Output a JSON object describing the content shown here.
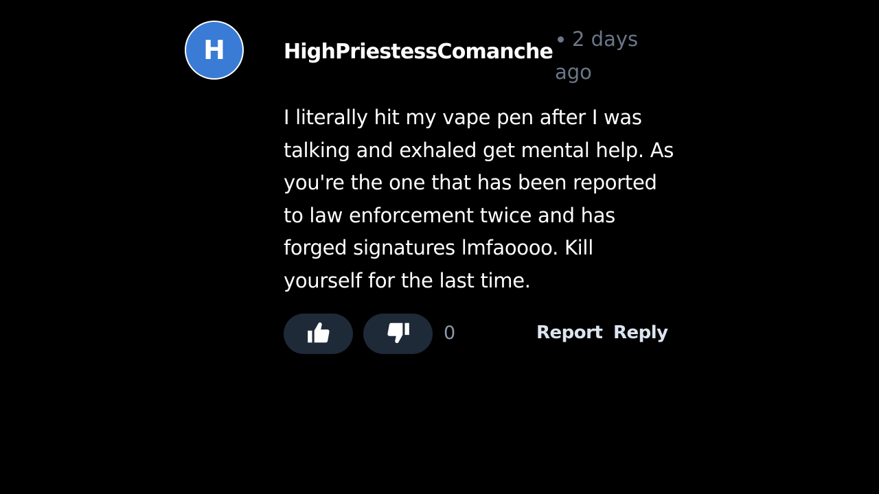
{
  "comment": {
    "avatar_initial": "H",
    "avatar_color": "#3a7bd5",
    "username": "HighPriestessComanche",
    "timestamp": "2 days ago",
    "body": "I literally hit my vape pen after I was talking and exhaled get mental help. As you're the one that has been reported to law enforcement twice and has forged signatures lmfaoooo. Kill yourself for the last time.",
    "vote_count": "0",
    "actions": {
      "upvote_icon": "thumbs-up-icon",
      "downvote_icon": "thumbs-down-icon",
      "report_label": "Report",
      "reply_label": "Reply"
    }
  },
  "colors": {
    "background": "#000000",
    "button_bg": "#1e2a38",
    "meta_text": "#6b7788",
    "action_text": "#dbe4ef"
  }
}
